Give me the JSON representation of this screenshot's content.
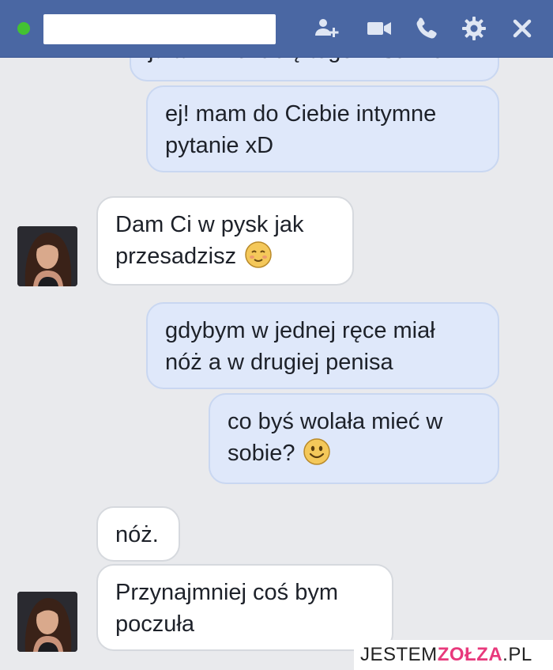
{
  "header": {
    "status_color": "#43c232",
    "bar_color": "#4a67a3",
    "icons": [
      "add-people-icon",
      "video-call-icon",
      "phone-call-icon",
      "gear-icon",
      "close-icon"
    ]
  },
  "messages": [
    {
      "side": "out",
      "text": "ja tam nie lubię tego w sumie"
    },
    {
      "side": "out",
      "text": "ej! mam do Ciebie intymne\npytanie xD"
    },
    {
      "side": "in",
      "text": "Dam Ci w pysk jak\nprzesadzisz",
      "emoji": "blushing-smiley-icon"
    },
    {
      "side": "out",
      "text": "gdybym w jednej ręce miał\nnóż a w drugiej penisa"
    },
    {
      "side": "out",
      "text": "co byś wolała mieć w\nsobie?",
      "emoji": "smiley-icon"
    },
    {
      "side": "in",
      "text": "nóż."
    },
    {
      "side": "in",
      "text": "Przynajmniej coś bym\npoczuła"
    }
  ],
  "watermark": {
    "part1": "JESTEM",
    "part2": "ZOŁZA",
    "part3": ".PL"
  }
}
